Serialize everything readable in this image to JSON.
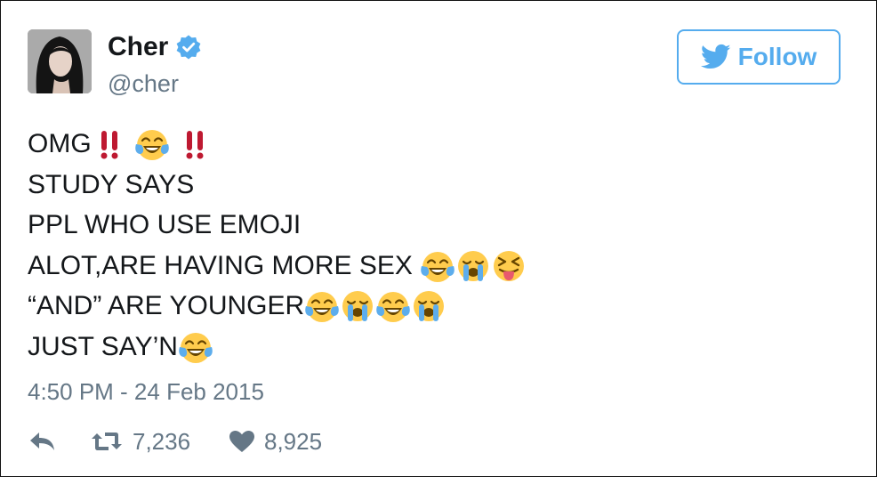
{
  "user": {
    "name": "Cher",
    "handle": "@cher",
    "verified": true
  },
  "follow_button": {
    "label": "Follow",
    "icon": "twitter-bird-icon"
  },
  "tweet": {
    "lines": [
      {
        "text": "OMG",
        "emoji": [
          "double-exclamation-icon",
          "face-with-tears-of-joy-icon",
          "double-exclamation-icon"
        ]
      },
      {
        "text": "STUDY SAYS",
        "emoji": []
      },
      {
        "text": "PPL WHO USE EMOJI",
        "emoji": []
      },
      {
        "text": "ALOT,ARE HAVING MORE SEX",
        "emoji": [
          "face-with-tears-of-joy-icon",
          "loudly-crying-face-icon",
          "squinting-face-with-tongue-icon"
        ]
      },
      {
        "text": "“AND” ARE YOUNGER",
        "emoji": [
          "face-with-tears-of-joy-icon",
          "loudly-crying-face-icon",
          "face-with-tears-of-joy-icon",
          "loudly-crying-face-icon"
        ]
      },
      {
        "text": "JUST SAY’N",
        "emoji": [
          "face-with-tears-of-joy-icon"
        ]
      }
    ],
    "timestamp": "4:50 PM - 24 Feb 2015"
  },
  "actions": {
    "reply_icon": "reply-icon",
    "retweet_icon": "retweet-icon",
    "retweet_count": "7,236",
    "like_icon": "heart-icon",
    "like_count": "8,925"
  },
  "colors": {
    "brand": "#55acee",
    "text": "#14171a",
    "muted": "#657786",
    "exclamation": "#be1931"
  }
}
